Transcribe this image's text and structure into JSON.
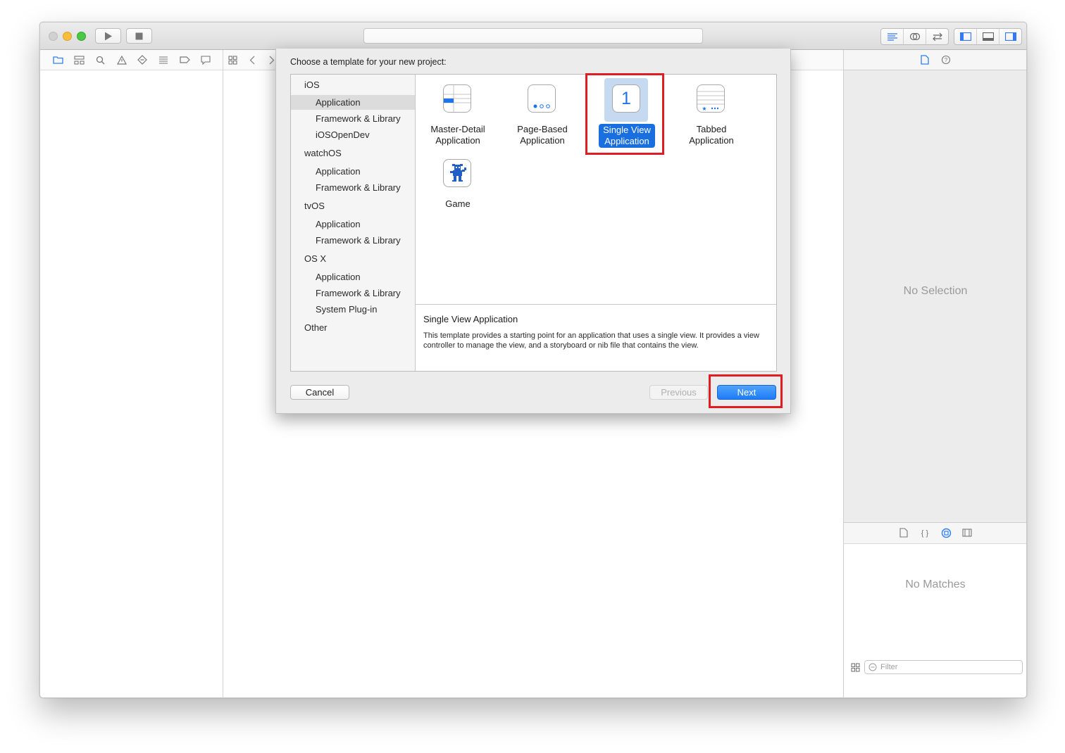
{
  "sheet": {
    "title": "Choose a template for your new project:",
    "categories": [
      {
        "name": "iOS",
        "items": [
          "Application",
          "Framework & Library",
          "iOSOpenDev"
        ]
      },
      {
        "name": "watchOS",
        "items": [
          "Application",
          "Framework & Library"
        ]
      },
      {
        "name": "tvOS",
        "items": [
          "Application",
          "Framework & Library"
        ]
      },
      {
        "name": "OS X",
        "items": [
          "Application",
          "Framework & Library",
          "System Plug-in"
        ]
      },
      {
        "name": "Other",
        "items": []
      }
    ],
    "selected_category": "iOS / Application",
    "templates": [
      {
        "line1": "Master-Detail",
        "line2": "Application",
        "icon": "master-detail-icon"
      },
      {
        "line1": "Page-Based",
        "line2": "Application",
        "icon": "page-based-icon"
      },
      {
        "line1": "Single View",
        "line2": "Application",
        "icon": "single-view-icon",
        "icon_text": "1"
      },
      {
        "line1": "Tabbed",
        "line2": "Application",
        "icon": "tabbed-icon"
      },
      {
        "line1": "Game",
        "line2": "",
        "icon": "game-icon"
      }
    ],
    "selected_template": "Single View Application",
    "description": {
      "title": "Single View Application",
      "text": "This template provides a starting point for an application that uses a single view. It provides a view controller to manage the view, and a storyboard or nib file that contains the view."
    },
    "buttons": {
      "cancel": "Cancel",
      "previous": "Previous",
      "next": "Next"
    }
  },
  "inspector": {
    "empty_text": "No Selection"
  },
  "library": {
    "empty_text": "No Matches",
    "filter_placeholder": "Filter"
  },
  "colors": {
    "accent": "#1a6fe0",
    "highlight": "#e11d24",
    "close": "#d0d0d0",
    "minimize": "#f6be3c",
    "zoom": "#4cc844"
  }
}
